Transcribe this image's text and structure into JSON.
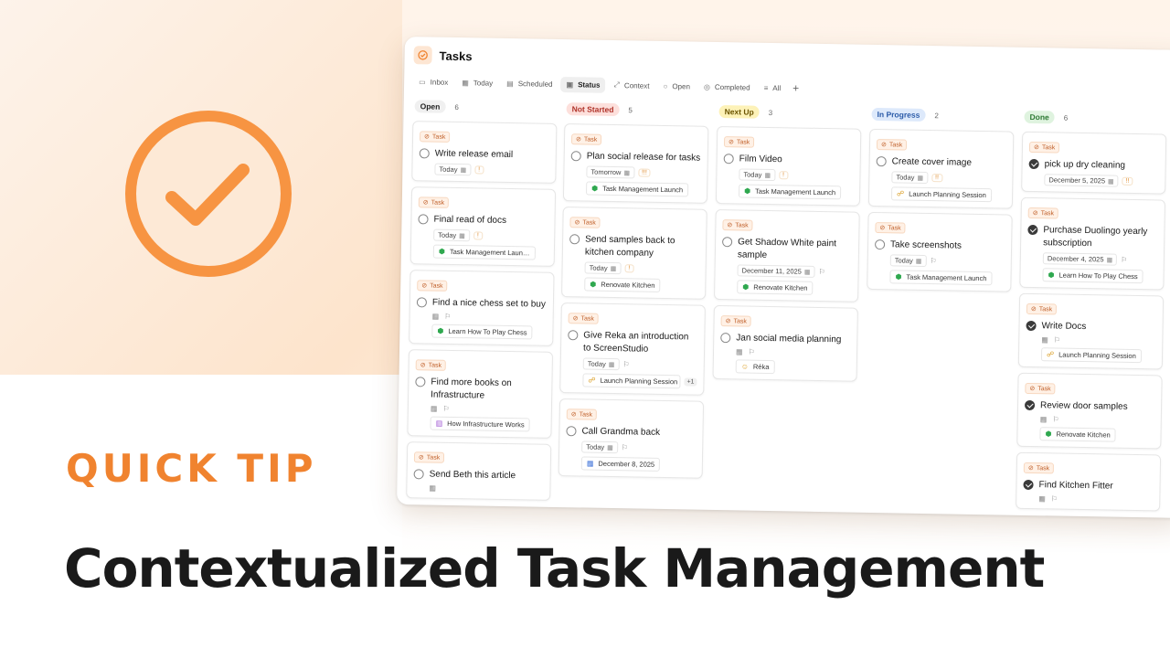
{
  "hero": {
    "quick_tip": "QUICK TIP",
    "headline": "Contextualized Task Management",
    "accent_color": "#f0832f"
  },
  "app": {
    "title": "Tasks",
    "tabs": [
      {
        "label": "Inbox",
        "icon": "inbox-icon"
      },
      {
        "label": "Today",
        "icon": "calendar-icon"
      },
      {
        "label": "Scheduled",
        "icon": "calendar-clock-icon"
      },
      {
        "label": "Status",
        "icon": "status-icon",
        "active": true
      },
      {
        "label": "Context",
        "icon": "context-icon"
      },
      {
        "label": "Open",
        "icon": "circle-icon"
      },
      {
        "label": "Completed",
        "icon": "check-circle-icon"
      },
      {
        "label": "All",
        "icon": "list-icon"
      }
    ],
    "add_tab": "+",
    "task_tag": "Task",
    "columns": [
      {
        "label": "Open",
        "count": "6",
        "pill_bg": "#f0f0f0",
        "pill_color": "#222",
        "cards": [
          {
            "title": "Write release email",
            "date": "Today",
            "prio": "!"
          },
          {
            "title": "Final read of docs",
            "date": "Today",
            "prio": "!",
            "project": "Task Management Laun…",
            "project_icon": "cube-icon"
          },
          {
            "title": "Find a nice chess set to buy",
            "date": "",
            "flag": true,
            "project": "Learn How To Play Chess",
            "project_icon": "cube-icon"
          },
          {
            "title": "Find more books on Infrastructure",
            "date": "",
            "flag": true,
            "project": "How Infrastructure Works",
            "project_icon": "book-icon"
          },
          {
            "title": "Send Beth this article",
            "date": ""
          }
        ]
      },
      {
        "label": "Not Started",
        "count": "5",
        "pill_bg": "#fde0dc",
        "pill_color": "#b0332a",
        "cards": [
          {
            "title": "Plan social release for tasks",
            "date": "Tomorrow",
            "prio": "!!!",
            "project": "Task Management Launch",
            "project_icon": "cube-icon"
          },
          {
            "title": "Send samples back to kitchen company",
            "date": "Today",
            "prio": "!",
            "project": "Renovate Kitchen",
            "project_icon": "cube-icon"
          },
          {
            "title": "Give Reka an introduction to ScreenStudio",
            "date": "Today",
            "flag": true,
            "project": "Launch Planning Session",
            "project_icon": "people-icon",
            "extra": "+1"
          },
          {
            "title": "Call Grandma back",
            "date": "Today",
            "flag": true,
            "project": "December 8, 2025",
            "project_icon": "calendar-icon"
          }
        ]
      },
      {
        "label": "Next Up",
        "count": "3",
        "pill_bg": "#fdf2b8",
        "pill_color": "#6b5400",
        "cards": [
          {
            "title": "Film Video",
            "date": "Today",
            "prio": "!",
            "project": "Task Management Launch",
            "project_icon": "cube-icon"
          },
          {
            "title": "Get Shadow White paint sample",
            "date": "December 11, 2025",
            "flag": true,
            "project": "Renovate Kitchen",
            "project_icon": "cube-icon"
          },
          {
            "title": "Jan social media planning",
            "date": "",
            "flag": true,
            "project": "Réka",
            "project_icon": "person-icon"
          }
        ]
      },
      {
        "label": "In Progress",
        "count": "2",
        "pill_bg": "#dde9fb",
        "pill_color": "#2a5aa8",
        "cards": [
          {
            "title": "Create cover image",
            "date": "Today",
            "prio": "!!",
            "project": "Launch Planning Session",
            "project_icon": "people-icon"
          },
          {
            "title": "Take screenshots",
            "date": "Today",
            "flag": true,
            "project": "Task Management Launch",
            "project_icon": "cube-icon"
          }
        ]
      },
      {
        "label": "Done",
        "count": "6",
        "pill_bg": "#dff3df",
        "pill_color": "#2e7a34",
        "cards": [
          {
            "title": "pick up dry cleaning",
            "date": "December 5, 2025",
            "prio": "!!",
            "done": true
          },
          {
            "title": "Purchase Duolingo yearly subscription",
            "date": "December 4, 2025",
            "flag": true,
            "project": "Learn How To Play Chess",
            "project_icon": "cube-icon",
            "done": true
          },
          {
            "title": "Write Docs",
            "date": "",
            "flag": true,
            "project": "Launch Planning Session",
            "project_icon": "people-icon",
            "done": true
          },
          {
            "title": "Review door samples",
            "date": "",
            "flag": true,
            "project": "Renovate Kitchen",
            "project_icon": "cube-icon",
            "done": true
          },
          {
            "title": "Find Kitchen Fitter",
            "date": "",
            "flag": true,
            "done": true
          }
        ]
      }
    ]
  }
}
